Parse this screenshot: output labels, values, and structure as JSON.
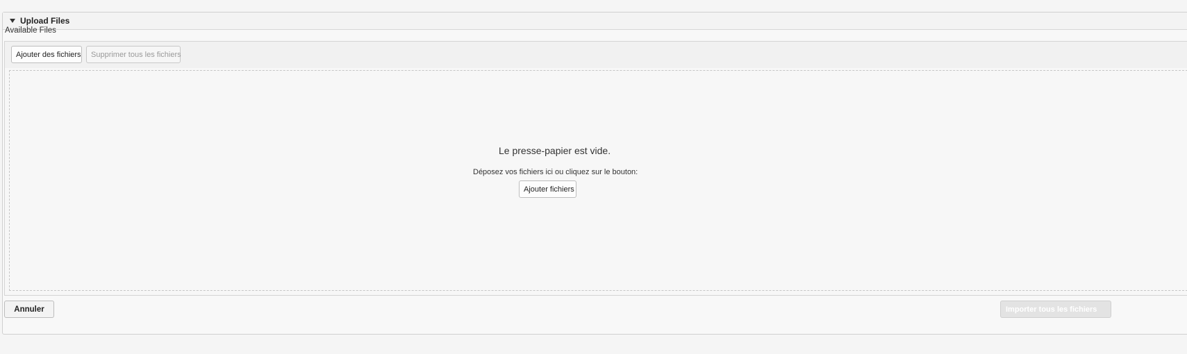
{
  "panel": {
    "title": "Upload Files",
    "caret_icon": "caret-down-icon"
  },
  "available_files_label": "Available Files",
  "toolbar": {
    "add_files_label": "Ajouter des fichiers",
    "remove_all_label": "Supprimer tous les fichiers"
  },
  "dropzone": {
    "empty_title": "Le presse-papier est vide.",
    "hint": "Déposez vos fichiers ici ou cliquez sur le bouton:",
    "add_button_label": "Ajouter fichiers"
  },
  "footer": {
    "cancel_label": "Annuler",
    "import_all_label": "Importer tous les fichiers"
  },
  "colors": {
    "background": "#f5f5f5",
    "panel_border": "#cfcfcf",
    "disabled_text": "#999999"
  }
}
